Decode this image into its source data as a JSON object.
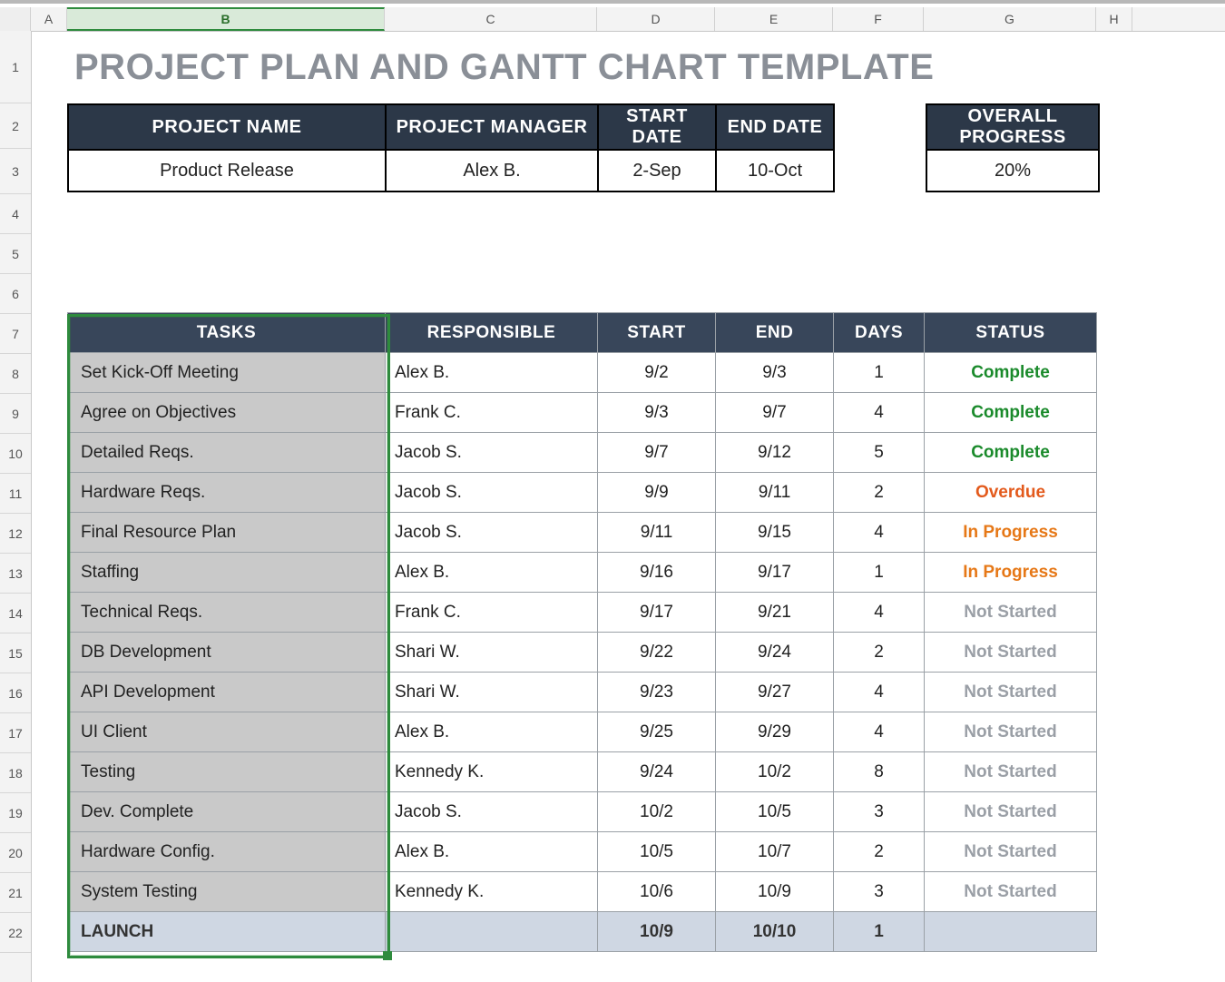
{
  "columns": [
    "A",
    "B",
    "C",
    "D",
    "E",
    "F",
    "G",
    "H"
  ],
  "rows": [
    "1",
    "2",
    "3",
    "4",
    "5",
    "6",
    "7",
    "8",
    "9",
    "10",
    "11",
    "12",
    "13",
    "14",
    "15",
    "16",
    "17",
    "18",
    "19",
    "20",
    "21",
    "22"
  ],
  "title": "PROJECT PLAN AND GANTT CHART TEMPLATE",
  "meta": {
    "headers": {
      "project_name": "PROJECT NAME",
      "project_manager": "PROJECT MANAGER",
      "start_date": "START DATE",
      "end_date": "END DATE",
      "overall_progress": "OVERALL PROGRESS"
    },
    "values": {
      "project_name": "Product Release",
      "project_manager": "Alex B.",
      "start_date": "2-Sep",
      "end_date": "10-Oct",
      "overall_progress": "20%"
    }
  },
  "tasks_header": {
    "tasks": "TASKS",
    "responsible": "RESPONSIBLE",
    "start": "START",
    "end": "END",
    "days": "DAYS",
    "status": "STATUS"
  },
  "status_class": {
    "Complete": "st-complete",
    "Overdue": "st-overdue",
    "In Progress": "st-in-progress",
    "Not Started": "st-not-started"
  },
  "tasks": [
    {
      "task": "Set Kick-Off Meeting",
      "responsible": "Alex B.",
      "start": "9/2",
      "end": "9/3",
      "days": "1",
      "status": "Complete"
    },
    {
      "task": "Agree on Objectives",
      "responsible": "Frank C.",
      "start": "9/3",
      "end": "9/7",
      "days": "4",
      "status": "Complete"
    },
    {
      "task": "Detailed Reqs.",
      "responsible": "Jacob S.",
      "start": "9/7",
      "end": "9/12",
      "days": "5",
      "status": "Complete"
    },
    {
      "task": "Hardware Reqs.",
      "responsible": "Jacob S.",
      "start": "9/9",
      "end": "9/11",
      "days": "2",
      "status": "Overdue"
    },
    {
      "task": "Final Resource Plan",
      "responsible": "Jacob S.",
      "start": "9/11",
      "end": "9/15",
      "days": "4",
      "status": "In Progress"
    },
    {
      "task": "Staffing",
      "responsible": "Alex B.",
      "start": "9/16",
      "end": "9/17",
      "days": "1",
      "status": "In Progress"
    },
    {
      "task": "Technical Reqs.",
      "responsible": "Frank C.",
      "start": "9/17",
      "end": "9/21",
      "days": "4",
      "status": "Not Started"
    },
    {
      "task": "DB Development",
      "responsible": "Shari W.",
      "start": "9/22",
      "end": "9/24",
      "days": "2",
      "status": "Not Started"
    },
    {
      "task": "API Development",
      "responsible": "Shari W.",
      "start": "9/23",
      "end": "9/27",
      "days": "4",
      "status": "Not Started"
    },
    {
      "task": "UI Client",
      "responsible": "Alex B.",
      "start": "9/25",
      "end": "9/29",
      "days": "4",
      "status": "Not Started"
    },
    {
      "task": "Testing",
      "responsible": "Kennedy K.",
      "start": "9/24",
      "end": "10/2",
      "days": "8",
      "status": "Not Started"
    },
    {
      "task": "Dev. Complete",
      "responsible": "Jacob S.",
      "start": "10/2",
      "end": "10/5",
      "days": "3",
      "status": "Not Started"
    },
    {
      "task": "Hardware Config.",
      "responsible": "Alex B.",
      "start": "10/5",
      "end": "10/7",
      "days": "2",
      "status": "Not Started"
    },
    {
      "task": "System Testing",
      "responsible": "Kennedy K.",
      "start": "10/6",
      "end": "10/9",
      "days": "3",
      "status": "Not Started"
    },
    {
      "task": "LAUNCH",
      "responsible": "",
      "start": "10/9",
      "end": "10/10",
      "days": "1",
      "status": "",
      "launch": true
    }
  ]
}
